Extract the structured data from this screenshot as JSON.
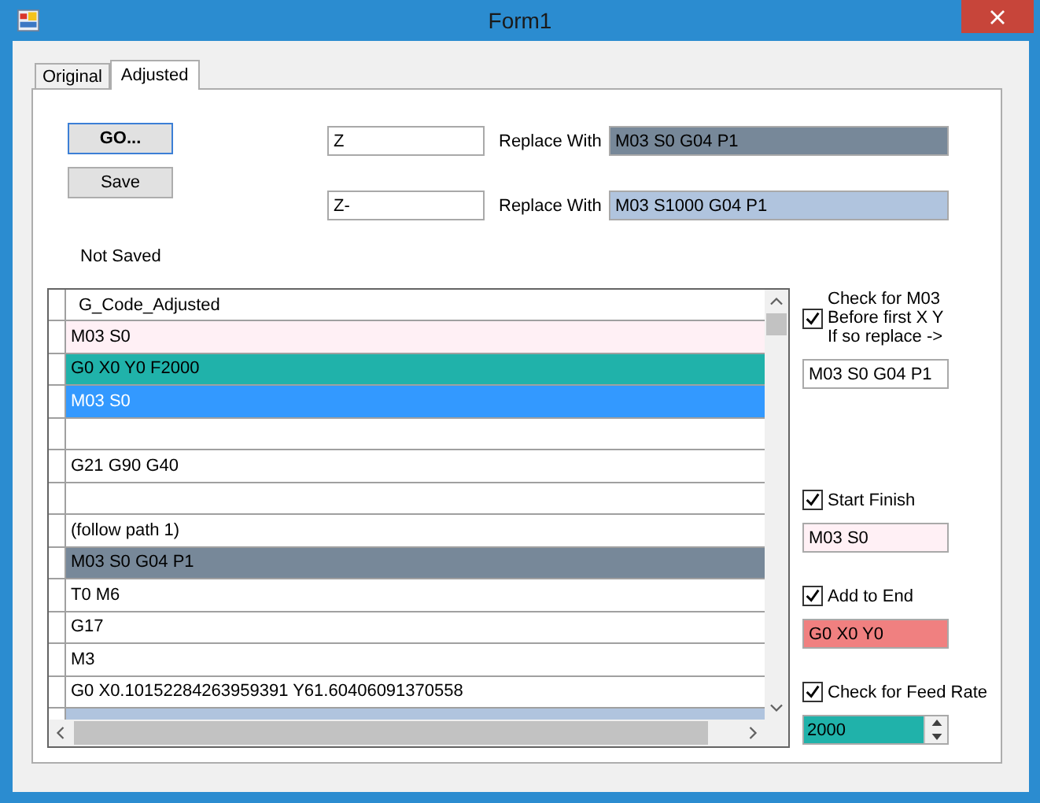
{
  "window": {
    "title": "Form1"
  },
  "tabs": [
    {
      "label": "Original",
      "selected": false
    },
    {
      "label": "Adjusted",
      "selected": true
    }
  ],
  "buttons": [
    {
      "label": "GO...",
      "default": true
    },
    {
      "label": "Save",
      "default": false
    }
  ],
  "status": "Not Saved",
  "replacements": [
    {
      "find": "Z",
      "label": "Replace With",
      "value": "M03 S0 G04 P1",
      "color": "#778899"
    },
    {
      "find": "Z-",
      "label": "Replace With",
      "value": "M03 S1000 G04 P1",
      "color": "#b0c4de"
    }
  ],
  "grid": {
    "column": "G_Code_Adjusted",
    "rows": [
      {
        "text": "M03 S0",
        "color": "#fff0f5",
        "selected": false
      },
      {
        "text": "G0 X0 Y0 F2000",
        "color": "#20b2aa",
        "selected": false
      },
      {
        "text": "M03 S0",
        "selected": true
      },
      {
        "selected": false
      },
      {
        "text": "G21 G90 G40",
        "color": "#ffffff",
        "selected": false
      },
      {
        "selected": false
      },
      {
        "text": "(follow path 1)",
        "color": "#ffffff",
        "selected": false
      },
      {
        "text": "M03 S0 G04 P1",
        "color": "#778899",
        "selected": false
      },
      {
        "text": "T0 M6",
        "color": "#ffffff",
        "selected": false
      },
      {
        "text": "G17",
        "color": "#ffffff",
        "selected": false
      },
      {
        "text": "M3",
        "color": "#ffffff",
        "selected": false
      },
      {
        "text": "G0 X0.10152284263959391 Y61.60406091370558",
        "color": "#ffffff",
        "selected": false
      },
      {
        "color": "#b0c4de",
        "selected": false
      }
    ]
  },
  "options": [
    {
      "kind": "text",
      "label_lines": [
        "Check for M03",
        "Before first X Y",
        "If so replace ->"
      ],
      "checked": true,
      "value": "M03 S0 G04 P1",
      "color": "#ffffff"
    },
    {
      "kind": "text",
      "label_lines": [
        "Start  Finish"
      ],
      "checked": true,
      "value": "M03 S0",
      "color": "#fff0f5"
    },
    {
      "kind": "text",
      "label_lines": [
        "Add to End"
      ],
      "checked": true,
      "value": "G0 X0 Y0",
      "color": "#f08080"
    },
    {
      "kind": "spinner",
      "label_lines": [
        "Check for Feed Rate"
      ],
      "checked": true,
      "value": "2000",
      "color": "#20b2aa"
    }
  ]
}
